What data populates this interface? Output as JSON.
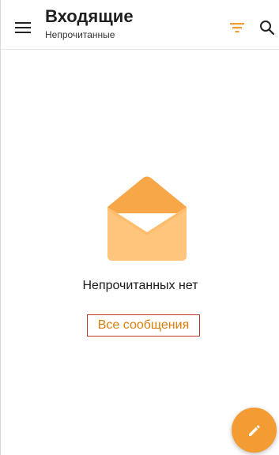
{
  "header": {
    "title": "Входящие",
    "subtitle": "Непрочитанные",
    "icons": {
      "menu": "hamburger-menu-icon",
      "filter": "filter-icon",
      "search": "search-icon"
    }
  },
  "empty_state": {
    "icon": "open-envelope-icon",
    "title": "Непрочитанных нет",
    "action_label": "Все сообщения"
  },
  "fab": {
    "icon": "pencil-icon"
  },
  "colors": {
    "accent": "#f39c34",
    "accent_text": "#d97e0a",
    "highlight_border": "#c0392b",
    "envelope_light": "#ffc57d",
    "envelope_dark": "#f7a748"
  }
}
